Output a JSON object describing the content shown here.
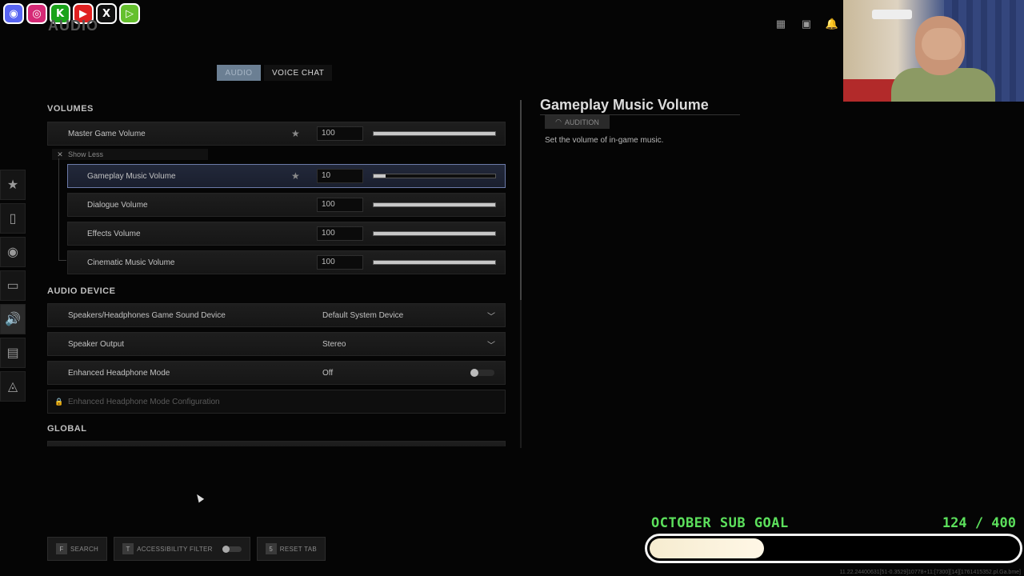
{
  "social_icons": [
    {
      "name": "discord",
      "glyph": "◉",
      "color": "#5865f2"
    },
    {
      "name": "instagram",
      "glyph": "◎",
      "color": "#d62976"
    },
    {
      "name": "kick",
      "glyph": "K",
      "color": "#1aa31a"
    },
    {
      "name": "youtube",
      "glyph": "▶",
      "color": "#e02020"
    },
    {
      "name": "x",
      "glyph": "X",
      "color": "#111111"
    },
    {
      "name": "rumble",
      "glyph": "▷",
      "color": "#65c02e"
    }
  ],
  "page": {
    "title": "AUDIO"
  },
  "tabs": [
    {
      "label": "AUDIO",
      "active": true
    },
    {
      "label": "VOICE CHAT",
      "active": false
    }
  ],
  "left_rail": [
    {
      "icon": "star-icon",
      "glyph": "★"
    },
    {
      "icon": "mouse-icon",
      "glyph": "▯"
    },
    {
      "icon": "controller-icon",
      "glyph": "◉"
    },
    {
      "icon": "display-icon",
      "glyph": "▭"
    },
    {
      "icon": "speaker-icon",
      "glyph": "🔊"
    },
    {
      "icon": "interface-icon",
      "glyph": "▤"
    },
    {
      "icon": "network-icon",
      "glyph": "◬"
    }
  ],
  "sections": {
    "volumes": "VOLUMES",
    "audio_device": "AUDIO DEVICE",
    "global": "GLOBAL"
  },
  "volumes": {
    "master": {
      "label": "Master Game Volume",
      "value": "100",
      "level": 1.0
    },
    "show_less": "Show Less",
    "sub": [
      {
        "label": "Gameplay Music Volume",
        "value": "10",
        "level": 0.1,
        "selected": true,
        "favorite": true
      },
      {
        "label": "Dialogue Volume",
        "value": "100",
        "level": 1.0
      },
      {
        "label": "Effects Volume",
        "value": "100",
        "level": 1.0
      },
      {
        "label": "Cinematic Music Volume",
        "value": "100",
        "level": 1.0
      }
    ]
  },
  "audio_device": [
    {
      "label": "Speakers/Headphones Game Sound Device",
      "value": "Default System Device",
      "type": "dropdown"
    },
    {
      "label": "Speaker Output",
      "value": "Stereo",
      "type": "dropdown"
    },
    {
      "label": "Enhanced Headphone Mode",
      "value": "Off",
      "type": "toggle"
    },
    {
      "label": "Enhanced Headphone Mode Configuration",
      "value": "",
      "type": "locked"
    }
  ],
  "detail": {
    "title": "Gameplay Music Volume",
    "audition_label": "AUDITION",
    "description": "Set the volume of in-game music."
  },
  "footer": [
    {
      "key": "F",
      "label": "SEARCH"
    },
    {
      "key": "T",
      "label": "ACCESSIBILITY FILTER"
    },
    {
      "key": "5",
      "label": "RESET TAB"
    }
  ],
  "sub_goal": {
    "label": "OCTOBER SUB GOAL",
    "count": "124 / 400",
    "progress": 0.31
  },
  "build_string": "11.22.24400631[51-0.3529]10778+11:[7300][14][1761415352.pl.Ga.bme]"
}
